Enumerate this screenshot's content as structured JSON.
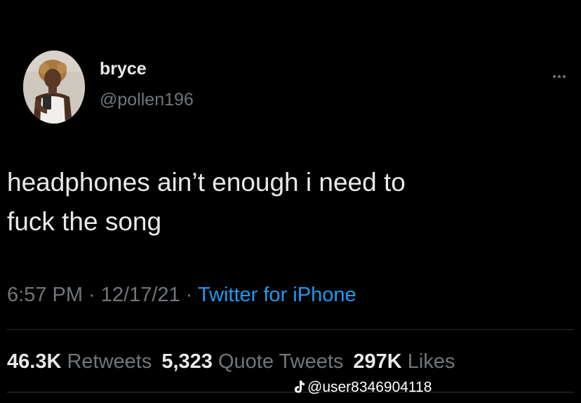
{
  "user": {
    "display_name": "bryce",
    "handle": "@pollen196",
    "avatar_icon": "profile-photo"
  },
  "tweet": {
    "text": "headphones ain’t enough i need to\nfuck the song",
    "time": "6:57 PM",
    "separator": " · ",
    "date": "12/17/21",
    "source": "Twitter for iPhone"
  },
  "stats": {
    "retweets_count": "46.3K",
    "retweets_label": "Retweets",
    "quotes_count": "5,323",
    "quotes_label": "Quote Tweets",
    "likes_count": "297K",
    "likes_label": "Likes"
  },
  "watermark": {
    "icon": "tiktok-icon",
    "text": "@user8346904118"
  },
  "colors": {
    "background": "#000000",
    "primary_text": "#e7e9ea",
    "secondary_text": "#71767b",
    "link": "#1d9bf0",
    "divider": "#2f3336"
  }
}
